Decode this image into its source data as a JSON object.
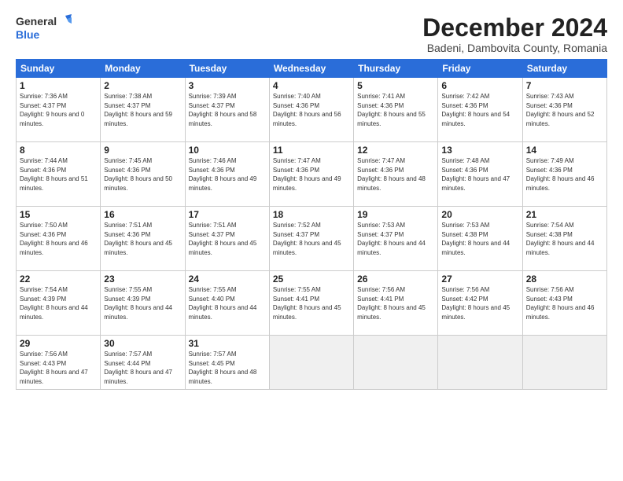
{
  "logo": {
    "general": "General",
    "blue": "Blue",
    "bird_symbol": "🐦"
  },
  "title": "December 2024",
  "location": "Badeni, Dambovita County, Romania",
  "weekdays": [
    "Sunday",
    "Monday",
    "Tuesday",
    "Wednesday",
    "Thursday",
    "Friday",
    "Saturday"
  ],
  "weeks": [
    [
      {
        "day": 1,
        "sunrise": "Sunrise: 7:36 AM",
        "sunset": "Sunset: 4:37 PM",
        "daylight": "Daylight: 9 hours and 0 minutes."
      },
      {
        "day": 2,
        "sunrise": "Sunrise: 7:38 AM",
        "sunset": "Sunset: 4:37 PM",
        "daylight": "Daylight: 8 hours and 59 minutes."
      },
      {
        "day": 3,
        "sunrise": "Sunrise: 7:39 AM",
        "sunset": "Sunset: 4:37 PM",
        "daylight": "Daylight: 8 hours and 58 minutes."
      },
      {
        "day": 4,
        "sunrise": "Sunrise: 7:40 AM",
        "sunset": "Sunset: 4:36 PM",
        "daylight": "Daylight: 8 hours and 56 minutes."
      },
      {
        "day": 5,
        "sunrise": "Sunrise: 7:41 AM",
        "sunset": "Sunset: 4:36 PM",
        "daylight": "Daylight: 8 hours and 55 minutes."
      },
      {
        "day": 6,
        "sunrise": "Sunrise: 7:42 AM",
        "sunset": "Sunset: 4:36 PM",
        "daylight": "Daylight: 8 hours and 54 minutes."
      },
      {
        "day": 7,
        "sunrise": "Sunrise: 7:43 AM",
        "sunset": "Sunset: 4:36 PM",
        "daylight": "Daylight: 8 hours and 52 minutes."
      }
    ],
    [
      {
        "day": 8,
        "sunrise": "Sunrise: 7:44 AM",
        "sunset": "Sunset: 4:36 PM",
        "daylight": "Daylight: 8 hours and 51 minutes."
      },
      {
        "day": 9,
        "sunrise": "Sunrise: 7:45 AM",
        "sunset": "Sunset: 4:36 PM",
        "daylight": "Daylight: 8 hours and 50 minutes."
      },
      {
        "day": 10,
        "sunrise": "Sunrise: 7:46 AM",
        "sunset": "Sunset: 4:36 PM",
        "daylight": "Daylight: 8 hours and 49 minutes."
      },
      {
        "day": 11,
        "sunrise": "Sunrise: 7:47 AM",
        "sunset": "Sunset: 4:36 PM",
        "daylight": "Daylight: 8 hours and 49 minutes."
      },
      {
        "day": 12,
        "sunrise": "Sunrise: 7:47 AM",
        "sunset": "Sunset: 4:36 PM",
        "daylight": "Daylight: 8 hours and 48 minutes."
      },
      {
        "day": 13,
        "sunrise": "Sunrise: 7:48 AM",
        "sunset": "Sunset: 4:36 PM",
        "daylight": "Daylight: 8 hours and 47 minutes."
      },
      {
        "day": 14,
        "sunrise": "Sunrise: 7:49 AM",
        "sunset": "Sunset: 4:36 PM",
        "daylight": "Daylight: 8 hours and 46 minutes."
      }
    ],
    [
      {
        "day": 15,
        "sunrise": "Sunrise: 7:50 AM",
        "sunset": "Sunset: 4:36 PM",
        "daylight": "Daylight: 8 hours and 46 minutes."
      },
      {
        "day": 16,
        "sunrise": "Sunrise: 7:51 AM",
        "sunset": "Sunset: 4:36 PM",
        "daylight": "Daylight: 8 hours and 45 minutes."
      },
      {
        "day": 17,
        "sunrise": "Sunrise: 7:51 AM",
        "sunset": "Sunset: 4:37 PM",
        "daylight": "Daylight: 8 hours and 45 minutes."
      },
      {
        "day": 18,
        "sunrise": "Sunrise: 7:52 AM",
        "sunset": "Sunset: 4:37 PM",
        "daylight": "Daylight: 8 hours and 45 minutes."
      },
      {
        "day": 19,
        "sunrise": "Sunrise: 7:53 AM",
        "sunset": "Sunset: 4:37 PM",
        "daylight": "Daylight: 8 hours and 44 minutes."
      },
      {
        "day": 20,
        "sunrise": "Sunrise: 7:53 AM",
        "sunset": "Sunset: 4:38 PM",
        "daylight": "Daylight: 8 hours and 44 minutes."
      },
      {
        "day": 21,
        "sunrise": "Sunrise: 7:54 AM",
        "sunset": "Sunset: 4:38 PM",
        "daylight": "Daylight: 8 hours and 44 minutes."
      }
    ],
    [
      {
        "day": 22,
        "sunrise": "Sunrise: 7:54 AM",
        "sunset": "Sunset: 4:39 PM",
        "daylight": "Daylight: 8 hours and 44 minutes."
      },
      {
        "day": 23,
        "sunrise": "Sunrise: 7:55 AM",
        "sunset": "Sunset: 4:39 PM",
        "daylight": "Daylight: 8 hours and 44 minutes."
      },
      {
        "day": 24,
        "sunrise": "Sunrise: 7:55 AM",
        "sunset": "Sunset: 4:40 PM",
        "daylight": "Daylight: 8 hours and 44 minutes."
      },
      {
        "day": 25,
        "sunrise": "Sunrise: 7:55 AM",
        "sunset": "Sunset: 4:41 PM",
        "daylight": "Daylight: 8 hours and 45 minutes."
      },
      {
        "day": 26,
        "sunrise": "Sunrise: 7:56 AM",
        "sunset": "Sunset: 4:41 PM",
        "daylight": "Daylight: 8 hours and 45 minutes."
      },
      {
        "day": 27,
        "sunrise": "Sunrise: 7:56 AM",
        "sunset": "Sunset: 4:42 PM",
        "daylight": "Daylight: 8 hours and 45 minutes."
      },
      {
        "day": 28,
        "sunrise": "Sunrise: 7:56 AM",
        "sunset": "Sunset: 4:43 PM",
        "daylight": "Daylight: 8 hours and 46 minutes."
      }
    ],
    [
      {
        "day": 29,
        "sunrise": "Sunrise: 7:56 AM",
        "sunset": "Sunset: 4:43 PM",
        "daylight": "Daylight: 8 hours and 47 minutes."
      },
      {
        "day": 30,
        "sunrise": "Sunrise: 7:57 AM",
        "sunset": "Sunset: 4:44 PM",
        "daylight": "Daylight: 8 hours and 47 minutes."
      },
      {
        "day": 31,
        "sunrise": "Sunrise: 7:57 AM",
        "sunset": "Sunset: 4:45 PM",
        "daylight": "Daylight: 8 hours and 48 minutes."
      },
      null,
      null,
      null,
      null
    ]
  ]
}
